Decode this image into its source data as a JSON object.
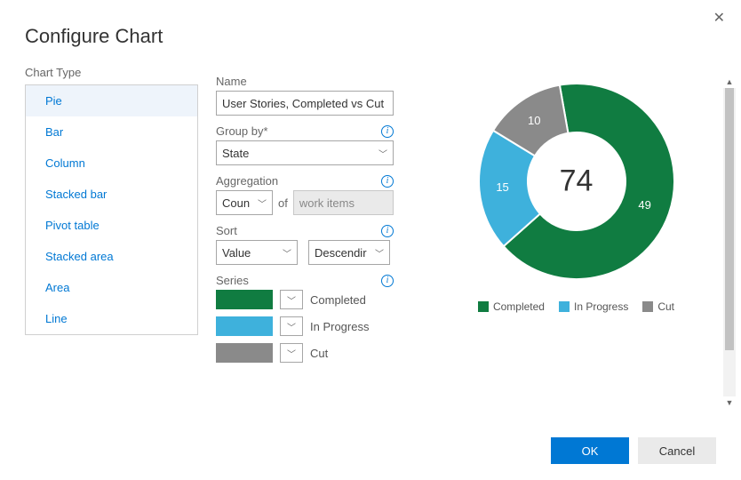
{
  "dialog": {
    "title": "Configure Chart"
  },
  "chart_type": {
    "label": "Chart Type",
    "items": [
      "Pie",
      "Bar",
      "Column",
      "Stacked bar",
      "Pivot table",
      "Stacked area",
      "Area",
      "Line"
    ],
    "selected_index": 0
  },
  "fields": {
    "name_label": "Name",
    "name_value": "User Stories, Completed vs Cut",
    "groupby_label": "Group by*",
    "groupby_value": "State",
    "agg_label": "Aggregation",
    "agg_value": "Coun",
    "agg_of": "of",
    "agg_disabled": "work items",
    "sort_label": "Sort",
    "sort_field": "Value",
    "sort_dir": "Descendir",
    "series_label": "Series"
  },
  "series": [
    {
      "label": "Completed",
      "color": "#107c41"
    },
    {
      "label": "In Progress",
      "color": "#3eb1dc"
    },
    {
      "label": "Cut",
      "color": "#8a8a8a"
    }
  ],
  "buttons": {
    "ok": "OK",
    "cancel": "Cancel"
  },
  "chart_data": {
    "type": "pie",
    "title": "",
    "total": 74,
    "series": [
      {
        "name": "Completed",
        "value": 49,
        "color": "#107c41"
      },
      {
        "name": "In Progress",
        "value": 15,
        "color": "#3eb1dc"
      },
      {
        "name": "Cut",
        "value": 10,
        "color": "#8a8a8a"
      }
    ]
  }
}
